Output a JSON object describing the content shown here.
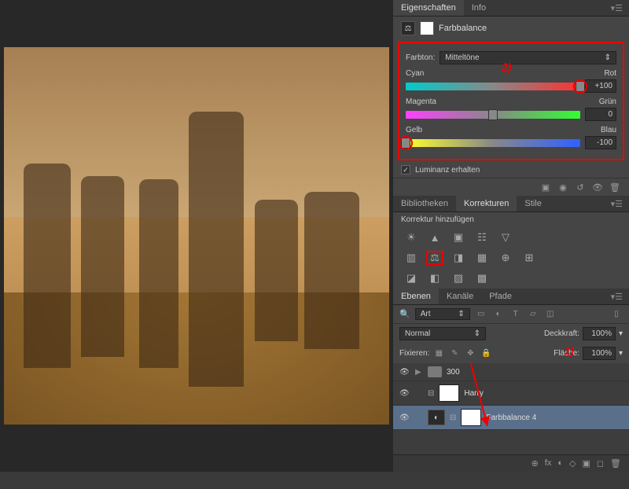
{
  "properties_panel": {
    "tabs": [
      "Eigenschaften",
      "Info"
    ],
    "active_tab": 0,
    "adjustment_title": "Farbbalance",
    "tone_label": "Farbton:",
    "tone_value": "Mitteltöne",
    "sliders": [
      {
        "left": "Cyan",
        "right": "Rot",
        "value": "+100",
        "pos": 100
      },
      {
        "left": "Magenta",
        "right": "Grün",
        "value": "0",
        "pos": 50
      },
      {
        "left": "Gelb",
        "right": "Blau",
        "value": "-100",
        "pos": 0
      }
    ],
    "preserve_luminosity": "Luminanz erhalten",
    "annotation": "2)"
  },
  "libraries_panel": {
    "tabs": [
      "Bibliotheken",
      "Korrekturen",
      "Stile"
    ],
    "active_tab": 1,
    "add_label": "Korrektur hinzufügen",
    "icons_row1": [
      "☀",
      "▲",
      "▣",
      "☷",
      "▽"
    ],
    "icons_row2": [
      "▥",
      "⚖",
      "◨",
      "▦",
      "⊕",
      "⊞"
    ],
    "icons_row3": [
      "◪",
      "◧",
      "▨",
      "▩"
    ]
  },
  "layers_panel": {
    "tabs": [
      "Ebenen",
      "Kanäle",
      "Pfade"
    ],
    "active_tab": 0,
    "filter_type": "Art",
    "blend_mode": "Normal",
    "opacity_label": "Deckkraft:",
    "opacity_value": "100%",
    "lock_label": "Fixieren:",
    "fill_label": "Fläche:",
    "fill_value": "100%",
    "annotation": "1)",
    "layers": [
      {
        "type": "group",
        "name": "300",
        "visible": true,
        "expanded": false
      },
      {
        "type": "adjustment",
        "name": "Harry",
        "visible": true
      },
      {
        "type": "adjustment",
        "name": "Farbbalance 4",
        "visible": true,
        "selected": true
      }
    ],
    "bottom_icons": [
      "⊕",
      "fx",
      "◐",
      "◇",
      "▣",
      "◻",
      "🗑"
    ]
  }
}
